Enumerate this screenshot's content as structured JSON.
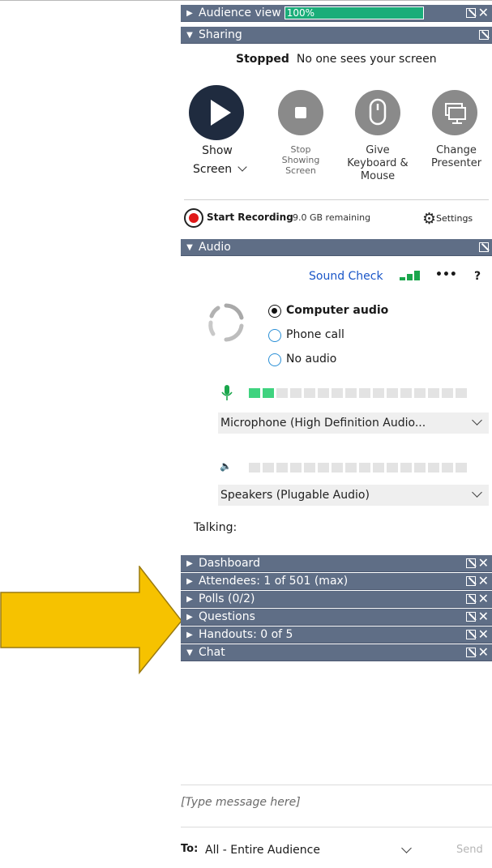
{
  "audience": {
    "title": "Audience view",
    "progress_label": "100%",
    "progress": 1.0
  },
  "sharing": {
    "title": "Sharing",
    "status_strong": "Stopped",
    "status_text": "No one sees your screen",
    "actions": [
      {
        "line1": "Show",
        "line2": "Screen"
      },
      {
        "line1": "Stop",
        "line2": "Showing",
        "line3": "Screen"
      },
      {
        "line1": "Give",
        "line2": "Keyboard &",
        "line3": "Mouse"
      },
      {
        "line1": "Change",
        "line2": "Presenter"
      }
    ],
    "record_label": "Start Recording",
    "remaining": "9.0 GB remaining",
    "settings_label": "Settings"
  },
  "audio": {
    "title": "Audio",
    "sound_check": "Sound Check",
    "more": "•••",
    "help": "?",
    "options": [
      "Computer audio",
      "Phone call",
      "No audio"
    ],
    "selected": 0,
    "mic_level": 2,
    "microphone": "Microphone (High  Definition Audio...",
    "speakers": "Speakers (Plugable Audio)",
    "talking": "Talking:"
  },
  "sections": [
    {
      "title": "Dashboard"
    },
    {
      "title": "Attendees: 1 of 501 (max)"
    },
    {
      "title": "Polls (0/2)"
    },
    {
      "title": "Questions"
    },
    {
      "title": "Handouts: 0 of 5"
    }
  ],
  "chat": {
    "title": "Chat",
    "placeholder": "[Type message here]",
    "to_label": "To:",
    "recipient": "All - Entire Audience",
    "send": "Send"
  },
  "colors": {
    "header": "#5f6e86",
    "progress": "#1aad79",
    "arrow": "#f6c200",
    "sound_check": "#1a56c8"
  }
}
